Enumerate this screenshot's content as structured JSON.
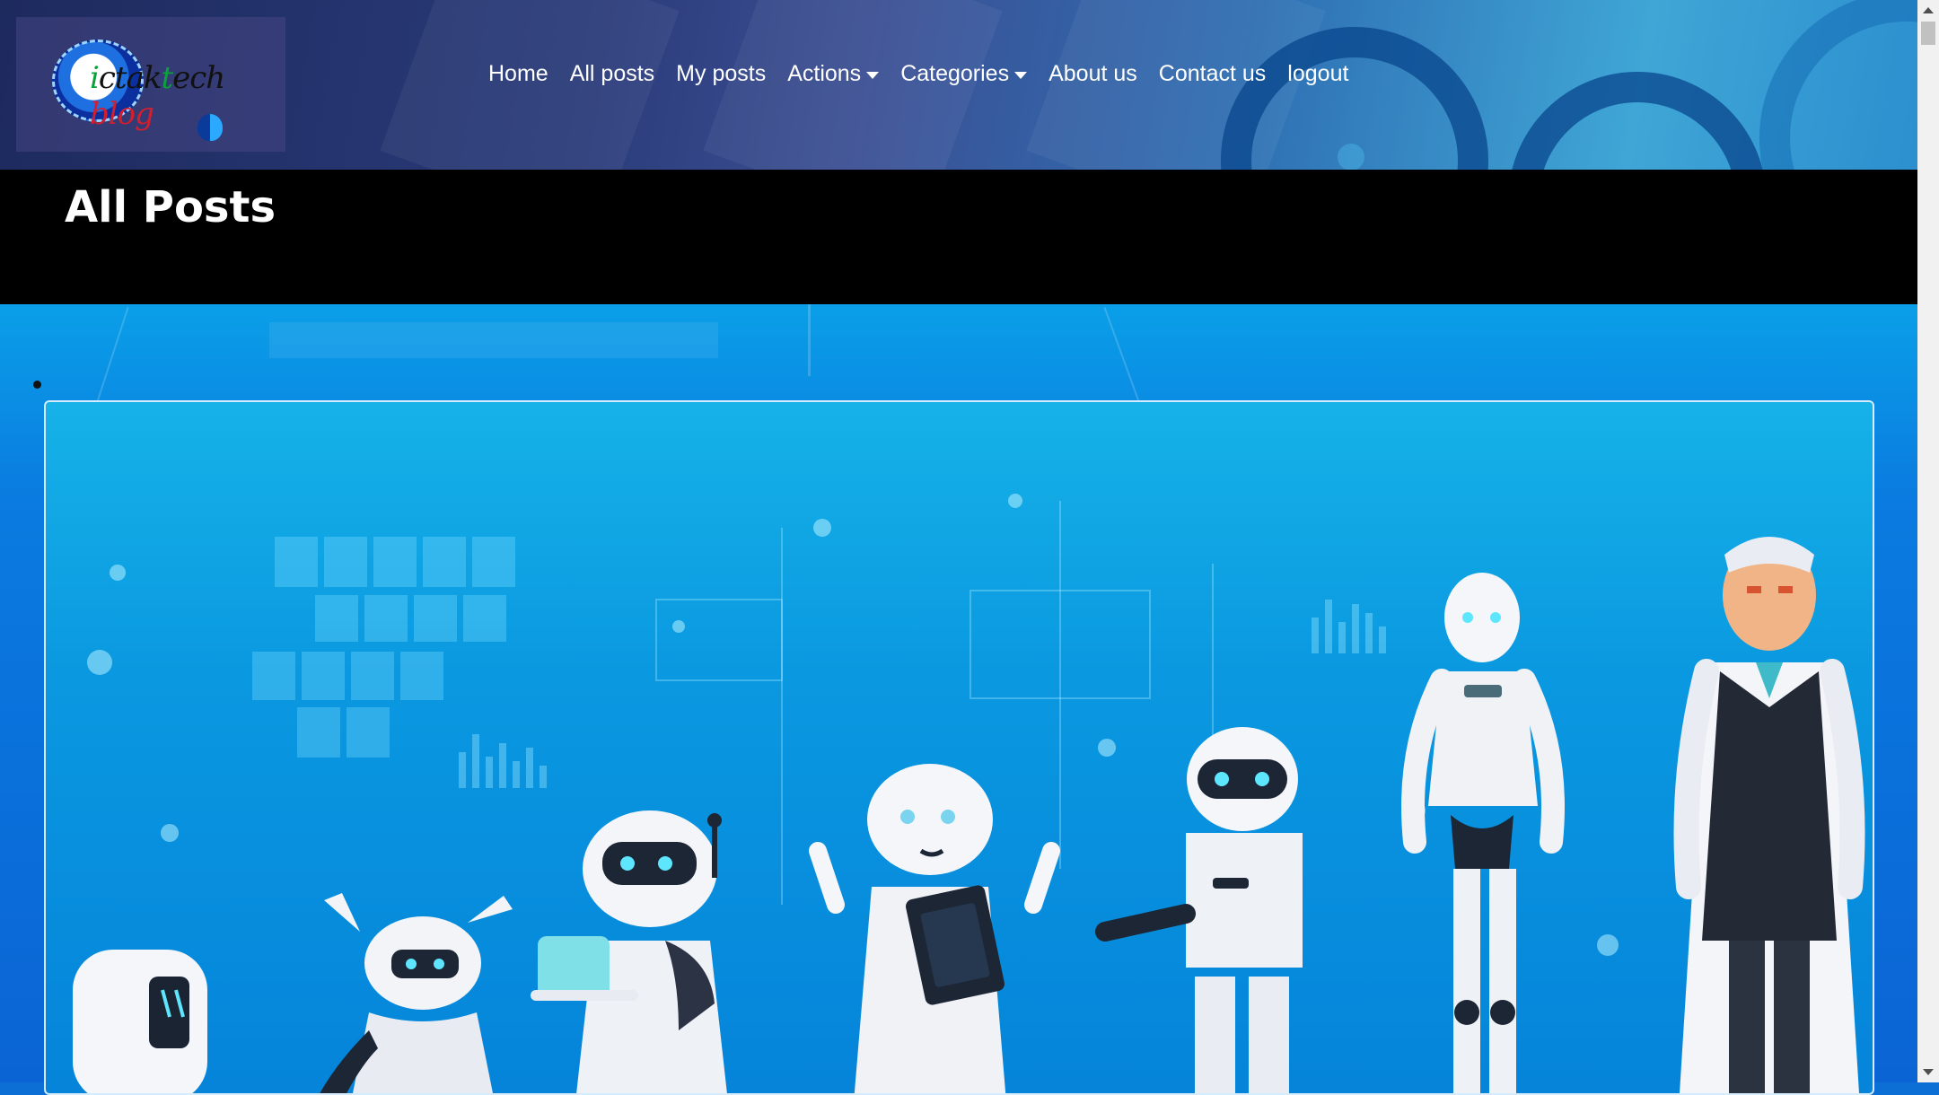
{
  "brand": {
    "logo_text_a": "i",
    "logo_text_b": "ctak",
    "logo_text_c": "t",
    "logo_text_d": "ech",
    "logo_text_e": "blog"
  },
  "nav": {
    "items": [
      {
        "label": "Home",
        "dropdown": false
      },
      {
        "label": "All posts",
        "dropdown": false
      },
      {
        "label": "My posts",
        "dropdown": false
      },
      {
        "label": "Actions",
        "dropdown": true
      },
      {
        "label": "Categories",
        "dropdown": true
      },
      {
        "label": "About us",
        "dropdown": false
      },
      {
        "label": "Contact us",
        "dropdown": false
      },
      {
        "label": "logout",
        "dropdown": false
      }
    ]
  },
  "page": {
    "title": "All Posts"
  },
  "colors": {
    "header_dark": "#1d2a5e",
    "title_band": "#000000",
    "main_blue": "#0b6fd6",
    "card_border": "#d5ecff"
  },
  "post_image": {
    "icon": "robots-illustration"
  }
}
